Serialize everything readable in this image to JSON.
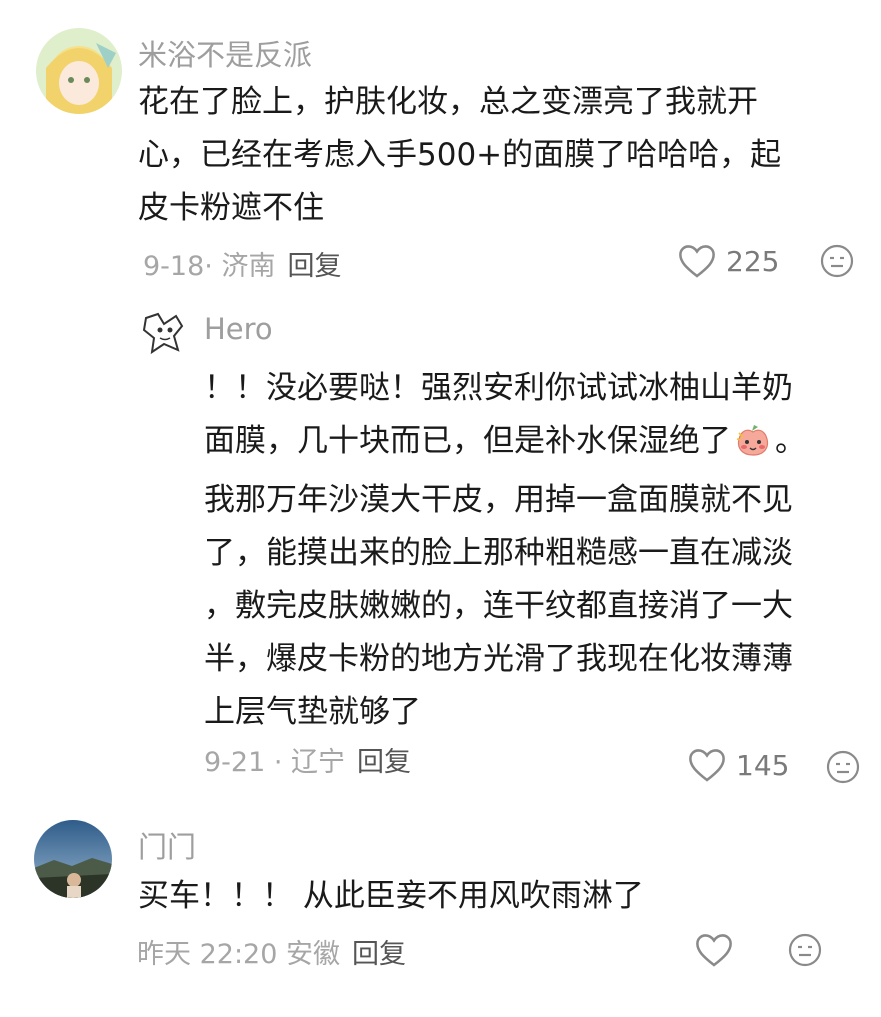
{
  "comments": [
    {
      "username": "米浴不是反派",
      "lines": [
        "花在了脸上，护肤化妆，总之变漂亮了我就开",
        "心，已经在考虑入手500+的面膜了哈哈哈，起",
        "皮卡粉遮不住"
      ],
      "meta": "9-18· 济南",
      "reply_label": "回复",
      "likes": "225"
    },
    {
      "username": "Hero",
      "lines": [
        "！！没必要哒！强烈安利你试试冰柚山羊奶",
        "面膜，几十块而已，但是补水保湿绝了",
        "。",
        "我那万年沙漠大干皮，用掉一盒面膜就不见",
        "了，能摸出来的脸上那种粗糙感一直在减淡",
        "，敷完皮肤嫩嫩的，连干纹都直接消了一大",
        "半，爆皮卡粉的地方光滑了我现在化妆薄薄",
        "上层气垫就够了"
      ],
      "meta": "9-21 · 辽宁",
      "reply_label": "回复",
      "likes": "145"
    },
    {
      "username": "门门",
      "lines": [
        "买车！！！ 从此臣妾不用风吹雨淋了"
      ],
      "meta": "昨天 22:20 安徽",
      "reply_label": "回复",
      "likes": ""
    }
  ],
  "icons": {
    "like": "heart-outline-icon",
    "react": "neutral-face-icon",
    "inline_emoji": "shy-blushing-peach-emoji"
  },
  "colors": {
    "text": "#1a1a1a",
    "secondary": "#9e9e9e",
    "icon": "#8a8a8a"
  }
}
